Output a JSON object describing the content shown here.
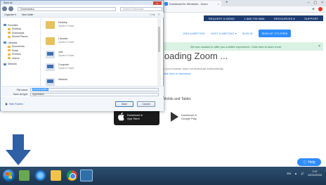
{
  "browser": {
    "tab_title": "Download for Windows - Zoom",
    "tab_close": "×",
    "new_tab": "+",
    "window_controls": [
      "–",
      "▢",
      "×"
    ]
  },
  "zoom_page": {
    "topnav": [
      "REQUEST A DEMO",
      "1.888.799.9666",
      "RESOURCES ▾",
      "SUPPORT"
    ],
    "nav2": [
      "JOIN A MEETING",
      "HOST A MEETING ▾",
      "SIGN IN"
    ],
    "signup_label": "SIGN UP, IT'S FREE",
    "notice": "We use cookies to offer you a better experience. Click here to learn more.",
    "notice_close": "×",
    "loading_title": "loading Zoom ...",
    "sub_line1": "If your browser does not download automatically,",
    "sub_line2": "click here to download",
    "mobile_text": "Mobile and Tablet.",
    "appstore": [
      "Download in",
      "App Store"
    ],
    "googleplay": [
      "Download in",
      "Google Play"
    ],
    "help_label": "Help"
  },
  "dialog": {
    "title": "Save As",
    "close": "x",
    "path": "Downloads ▸",
    "search_placeholder": "Search Downloads",
    "toolbar": [
      "Organize ▾",
      "New folder"
    ],
    "toolbar_right": [
      "⋮≡ ▾",
      "?"
    ],
    "sidebar": [
      {
        "label": "Favorites",
        "group": true
      },
      {
        "label": "Desktop",
        "group": false
      },
      {
        "label": "Downloads",
        "group": false
      },
      {
        "label": "Recent Places",
        "group": false
      },
      {
        "label": "Libraries",
        "group": true
      },
      {
        "label": "Documents",
        "group": false
      },
      {
        "label": "Music",
        "group": false
      },
      {
        "label": "Pictures",
        "group": false
      },
      {
        "label": "Videos",
        "group": false
      },
      {
        "label": "Network",
        "group": true
      }
    ],
    "files": [
      {
        "name": "Desktop",
        "sub": "System Folder",
        "kind": "folder"
      },
      {
        "name": "Libraries",
        "sub": "System Folder",
        "kind": "folder"
      },
      {
        "name": "user",
        "sub": "System Folder",
        "kind": "doc"
      },
      {
        "name": "Computer",
        "sub": "System Folder",
        "kind": "doc"
      },
      {
        "name": "Network",
        "sub": "",
        "kind": "doc"
      }
    ],
    "filename_label": "File name:",
    "filename_value": "ZoomInstaller",
    "savetype_label": "Save as type:",
    "savetype_value": "Application",
    "hide_folders": "Hide Folders",
    "save_label": "Save",
    "cancel_label": "Cancel"
  },
  "taskbar": {
    "tray_icons": [
      "EN",
      "▲",
      "🔊"
    ],
    "clock_time": "7:47",
    "clock_date": "12/21/2016"
  },
  "colors": {
    "zoom_blue": "#2d8cff",
    "zoom_navy": "#1d3c72",
    "arrow_blue": "#2f5fa4",
    "notice_green": "#d9f2e3"
  }
}
